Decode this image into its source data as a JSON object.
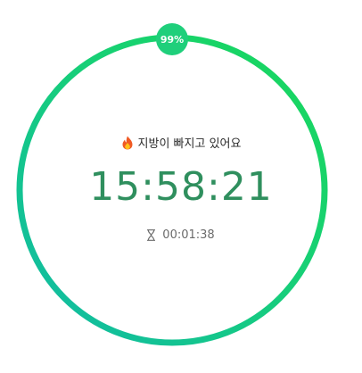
{
  "progress": {
    "percent": 99,
    "label": "99%"
  },
  "status": {
    "icon": "fire-icon",
    "text": "지방이 빠지고 있어요"
  },
  "timer": {
    "remaining": "15:58:21"
  },
  "elapsed": {
    "icon": "hourglass-icon",
    "value": "00:01:38"
  },
  "colors": {
    "ring_start": "#10b9a8",
    "ring_end": "#18d85a",
    "badge": "#1fcf7b",
    "timer_text": "#2f8f5e",
    "status_text": "#2b2b2b",
    "elapsed_text": "#6b6b6b"
  }
}
